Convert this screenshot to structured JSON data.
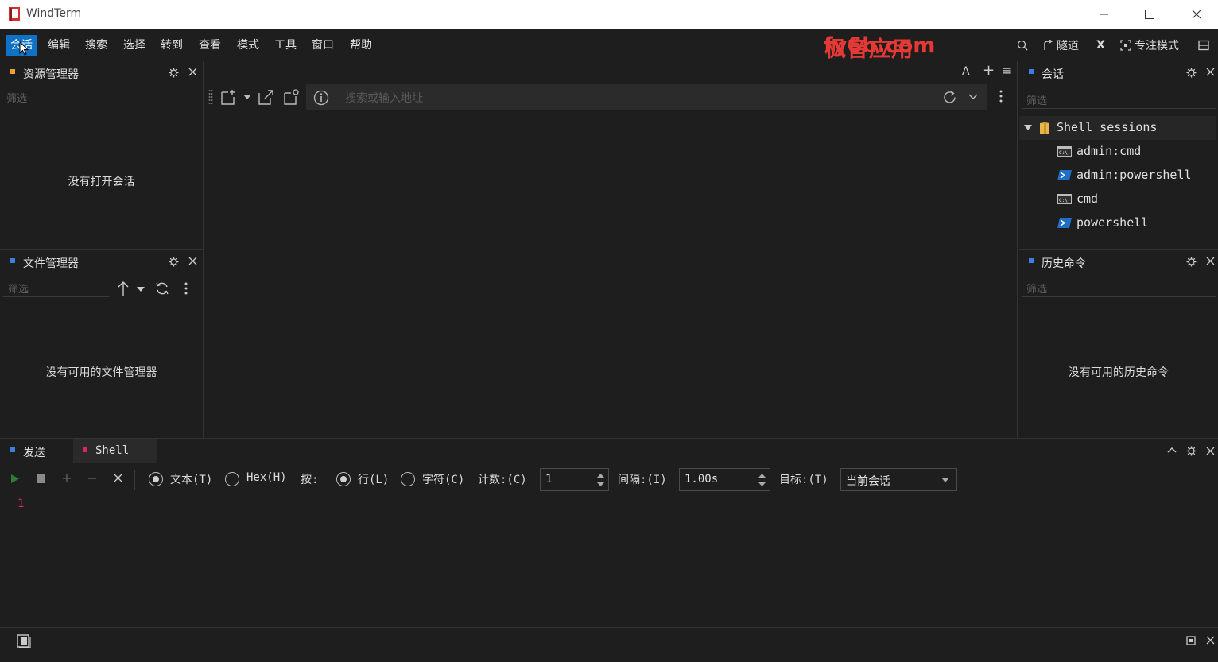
{
  "window": {
    "title": "WindTerm",
    "minimize_icon": "minimize-icon",
    "maximize_icon": "maximize-icon",
    "close_icon": "close-icon"
  },
  "menu": {
    "items": [
      "会话",
      "编辑",
      "搜索",
      "选择",
      "转到",
      "查看",
      "模式",
      "工具",
      "窗口",
      "帮助"
    ],
    "active": "会话",
    "right": {
      "tunnel_label": "隧道",
      "x_label": "X",
      "focus_label": "专注模式"
    }
  },
  "watermark": {
    "line1": "枫音应用",
    "line2": "fy6b.com"
  },
  "explorer": {
    "title": "资源管理器",
    "filter_placeholder": "筛选",
    "empty": "没有打开会话"
  },
  "file_manager": {
    "title": "文件管理器",
    "filter_placeholder": "筛选",
    "empty": "没有可用的文件管理器"
  },
  "center": {
    "address_placeholder": "搜索或输入地址",
    "font_button": "A",
    "add_button": "+",
    "menu_button": "≡"
  },
  "sessions": {
    "title": "会话",
    "filter_placeholder": "筛选",
    "group": "Shell sessions",
    "items": [
      {
        "label": "admin:cmd",
        "icon": "cmd-icon"
      },
      {
        "label": "admin:powershell",
        "icon": "powershell-icon"
      },
      {
        "label": "cmd",
        "icon": "cmd-icon"
      },
      {
        "label": "powershell",
        "icon": "powershell-icon"
      }
    ]
  },
  "history": {
    "title": "历史命令",
    "filter_placeholder": "筛选",
    "empty": "没有可用的历史命令"
  },
  "send": {
    "tabs": [
      "发送",
      "Shell"
    ],
    "text_option": "文本(T)",
    "hex_option": "Hex(H)",
    "by_label": "按:",
    "line_option": "行(L)",
    "char_option": "字符(C)",
    "count_label": "计数:(C)",
    "count_value": "1",
    "interval_label": "间隔:(I)",
    "interval_value": "1.00s",
    "target_label": "目标:(T)",
    "target_value": "当前会话",
    "line_number": "1"
  },
  "colors": {
    "accent": "#0e72c6",
    "explorer_marker": "#f0a030",
    "blue_marker": "#3d7fe0",
    "shell_marker": "#e0245e",
    "watermark": "#e53935",
    "play": "#2e7d32"
  }
}
